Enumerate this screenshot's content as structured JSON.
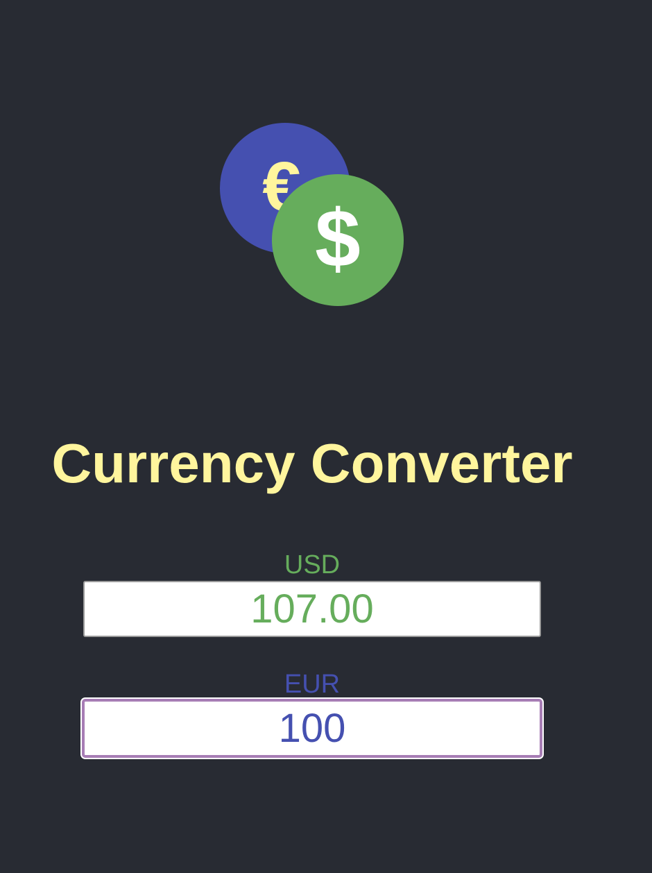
{
  "app": {
    "title": "Currency Converter",
    "logo_icon": "currency-coins-icon"
  },
  "converter": {
    "usd": {
      "label": "USD",
      "value": "107.00",
      "color": "#66ad5c"
    },
    "eur": {
      "label": "EUR",
      "value": "100",
      "color": "#4550b0",
      "focused": true
    }
  },
  "colors": {
    "background": "#282b33",
    "title": "#fff59d",
    "euro_coin": "#4550b0",
    "dollar_coin": "#66ad5c",
    "focus_ring": "#a77db5"
  }
}
